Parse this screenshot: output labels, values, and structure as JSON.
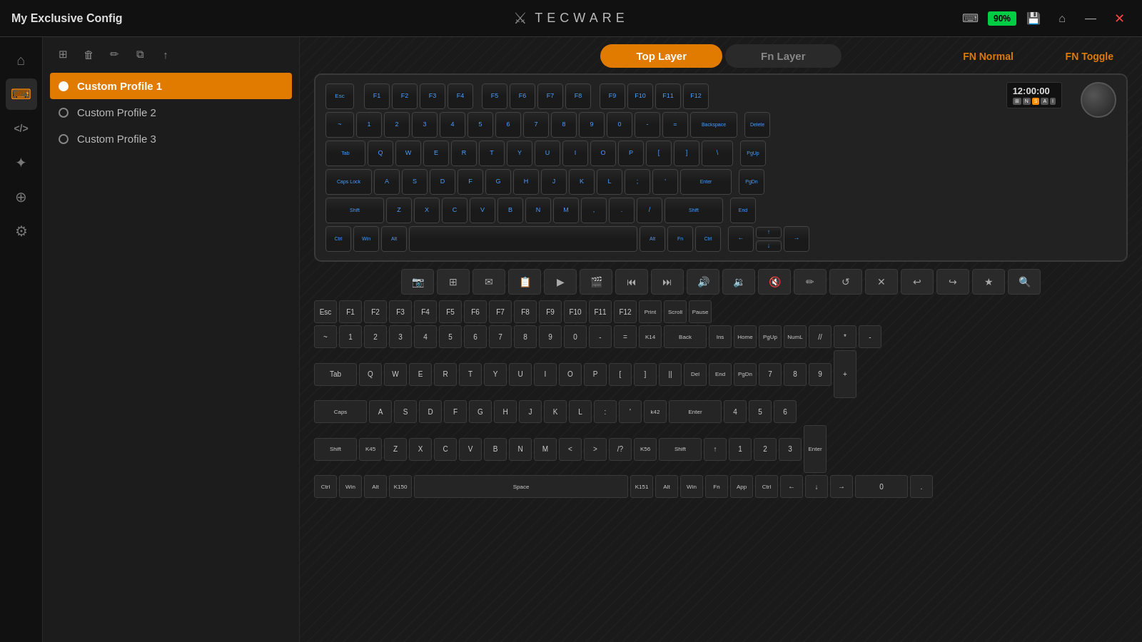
{
  "app": {
    "title": "My Exclusive Config",
    "battery": "90%",
    "logo_text": "TECWARE"
  },
  "titlebar": {
    "keyboard_icon": "⌨",
    "save_icon": "💾",
    "home_icon": "⌂",
    "minimize_icon": "—",
    "close_icon": "✕"
  },
  "sidebar": {
    "items": [
      {
        "id": "home",
        "icon": "⌂",
        "active": false
      },
      {
        "id": "keyboard",
        "icon": "⌨",
        "active": true
      },
      {
        "id": "macro",
        "icon": "</>",
        "active": false
      },
      {
        "id": "lighting",
        "icon": "✦",
        "active": false
      },
      {
        "id": "network",
        "icon": "⊕",
        "active": false
      },
      {
        "id": "settings",
        "icon": "⚙",
        "active": false
      }
    ]
  },
  "profiles": {
    "toolbar": {
      "add": "+",
      "delete": "🗑",
      "edit": "✏",
      "copy": "⧉",
      "export": "↑"
    },
    "items": [
      {
        "id": "profile1",
        "label": "Custom Profile 1",
        "active": true
      },
      {
        "id": "profile2",
        "label": "Custom Profile 2",
        "active": false
      },
      {
        "id": "profile3",
        "label": "Custom Profile 3",
        "active": false
      }
    ]
  },
  "layers": {
    "top_label": "Top Layer",
    "fn_label": "Fn Layer",
    "fn_normal_label": "FN Normal",
    "fn_toggle_label": "FN Toggle",
    "active": "top"
  },
  "clock": {
    "time": "12:00:00"
  },
  "macro_toolbar": {
    "icons": [
      "📷",
      "⊞",
      "✉",
      "📋",
      "▶",
      "🎬",
      "⏮",
      "⏭",
      "🔊",
      "🔉",
      "🔇",
      "✏",
      "↺",
      "✕",
      "↩",
      "↪",
      "★",
      "🔍"
    ]
  },
  "keyboard_rows": {
    "row1": [
      "Esc",
      "F1",
      "F2",
      "F3",
      "F4",
      "F5",
      "F6",
      "F7",
      "F8",
      "F9",
      "F10",
      "F11",
      "F12"
    ],
    "row2": [
      "~",
      "1",
      "2",
      "3",
      "4",
      "5",
      "6",
      "7",
      "8",
      "9",
      "0",
      "-",
      "=",
      "Back"
    ],
    "row3": [
      "Tab",
      "Q",
      "W",
      "E",
      "R",
      "T",
      "Y",
      "U",
      "I",
      "O",
      "P",
      "[",
      "]",
      "\\"
    ],
    "row4": [
      "Caps",
      "A",
      "S",
      "D",
      "F",
      "G",
      "H",
      "J",
      "K",
      "L",
      ";",
      "'",
      "Enter"
    ],
    "row5": [
      "Shift",
      "Z",
      "X",
      "C",
      "V",
      "B",
      "N",
      "M",
      "<",
      ">",
      "/?",
      "Shift"
    ],
    "row6": [
      "Ctrl",
      "Win",
      "Alt",
      "Space",
      "Alt",
      "Fn",
      "Ctrl"
    ]
  },
  "keymapping_rows": {
    "row1_labels": [
      "Esc",
      "F1",
      "F2",
      "F3",
      "F4",
      "F5",
      "F6",
      "F7",
      "F8",
      "F9",
      "F10",
      "F11",
      "F12",
      "Print",
      "Scroll",
      "Pause"
    ],
    "row2_labels": [
      "~",
      "1",
      "2",
      "3",
      "4",
      "5",
      "6",
      "7",
      "8",
      "9",
      "0",
      "-",
      "=",
      "K14",
      "Back",
      "Ins",
      "Home",
      "PgUp",
      "NumL",
      "//",
      "*",
      "-"
    ],
    "row3_labels": [
      "Tab",
      "Q",
      "W",
      "E",
      "R",
      "T",
      "Y",
      "U",
      "I",
      "O",
      "P",
      "[",
      "]",
      "||",
      "Del",
      "End",
      "PgDn",
      "7",
      "8",
      "9",
      "+"
    ],
    "row4_labels": [
      "Caps",
      "A",
      "S",
      "D",
      "F",
      "G",
      "H",
      "J",
      "K",
      "L",
      ";",
      "'",
      "k42",
      "Enter",
      "4",
      "5",
      "6"
    ],
    "row5_labels": [
      "Shift",
      "K45",
      "Z",
      "X",
      "C",
      "V",
      "B",
      "N",
      "M",
      "<",
      ">",
      "/?",
      "K56",
      "Shift",
      "↑",
      "1",
      "2",
      "3",
      "Enter"
    ],
    "row6_labels": [
      "Ctrl",
      "Win",
      "Alt",
      "K150",
      "Space",
      "K151",
      "Alt",
      "Win",
      "Fn",
      "App",
      "Ctrl",
      "←",
      "↓",
      "→",
      "0",
      "."
    ]
  }
}
